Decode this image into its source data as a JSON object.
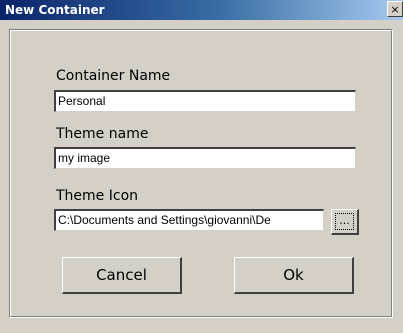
{
  "window": {
    "title": "New Container",
    "close_glyph": "×"
  },
  "form": {
    "container_name_label": "Container Name",
    "container_name_value": "Personal",
    "theme_name_label": "Theme name",
    "theme_name_value": "my image",
    "theme_icon_label": "Theme Icon",
    "theme_icon_value": "C:\\Documents and Settings\\giovanni\\De",
    "browse_label": "..."
  },
  "buttons": {
    "cancel_label": "Cancel",
    "ok_label": "Ok"
  },
  "colors": {
    "face": "#d4d0c8",
    "title_gradient_start": "#0a246a",
    "title_gradient_end": "#a6caf0"
  },
  "icons": {
    "close": "close-icon",
    "browse": "ellipsis-icon"
  }
}
